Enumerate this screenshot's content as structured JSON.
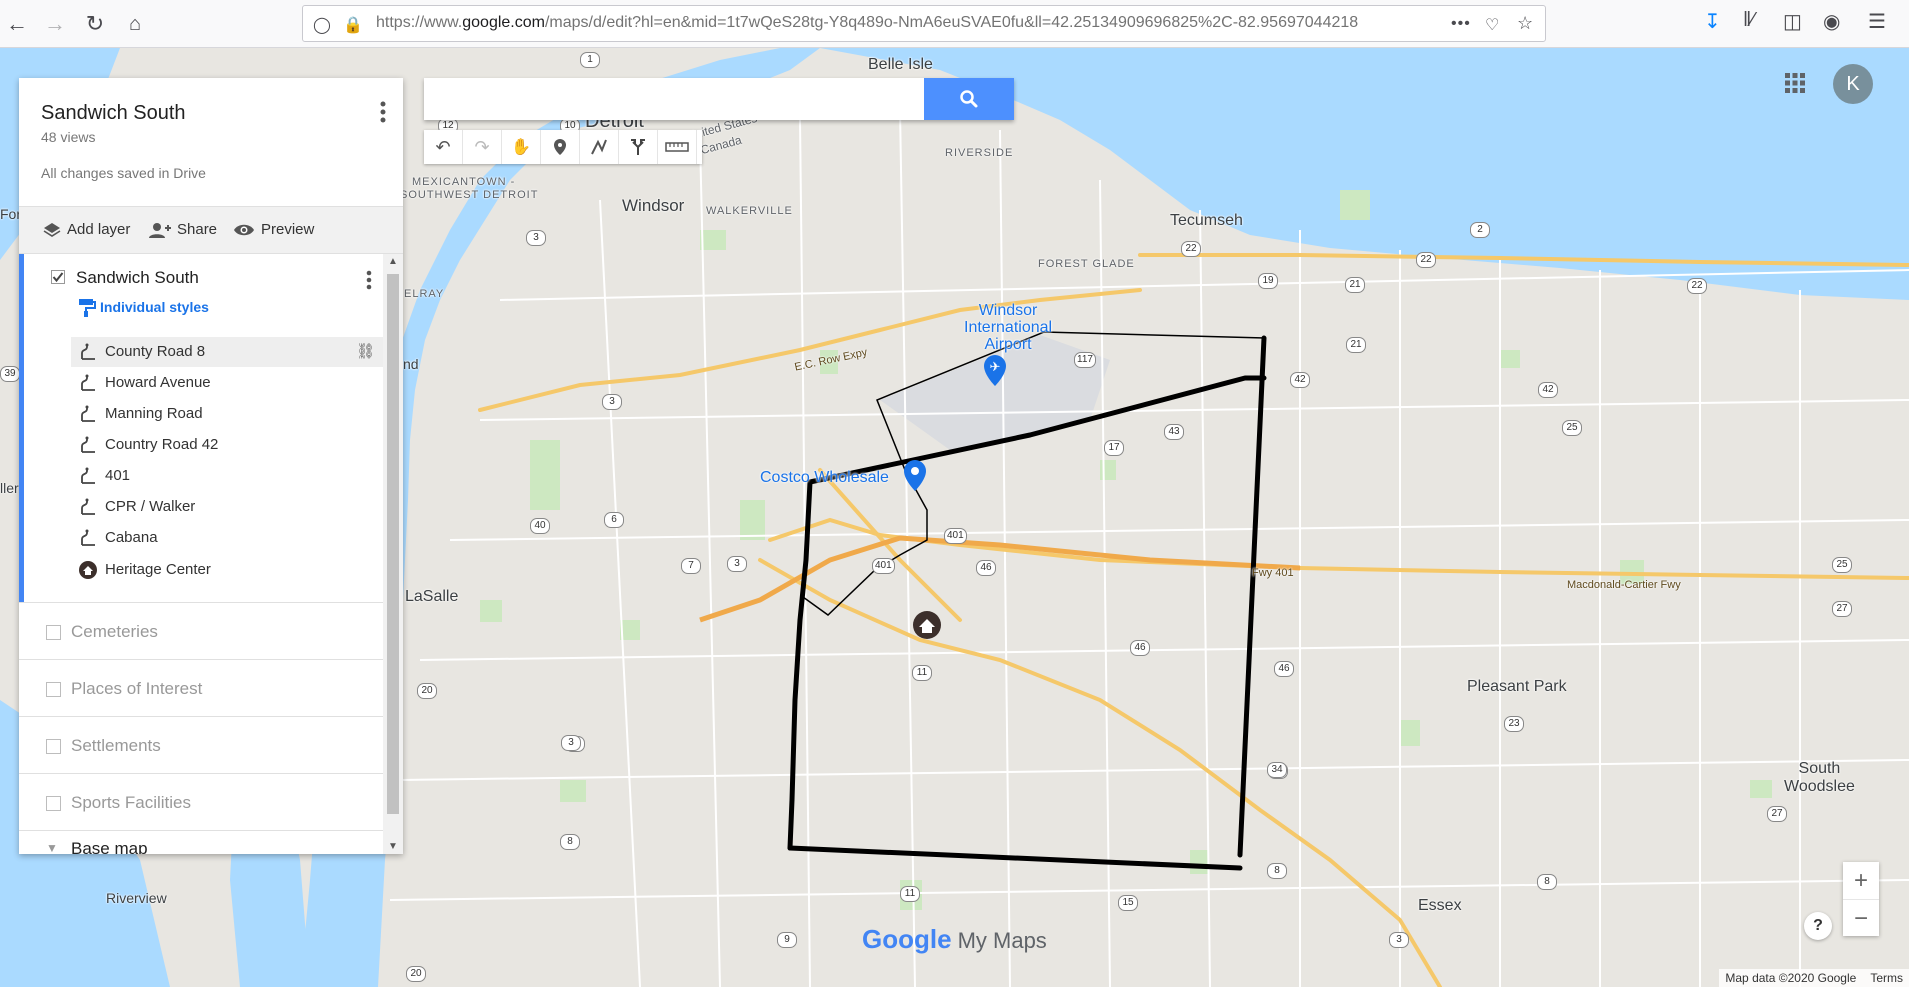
{
  "browser": {
    "url_host_prefix": "https://www.",
    "url_host": "google.com",
    "url_path": "/maps/d/edit?hl=en&mid=1t7wQeS28tg-Y8q489o-NmA6euSVAE0fu&ll=42.25134909696825%2C-82.95697044218",
    "overflow_menu": "•••"
  },
  "search": {
    "value": "",
    "placeholder": ""
  },
  "panel": {
    "map_title": "Sandwich South",
    "views": "48 views",
    "saved_status": "All changes saved in Drive",
    "actions": {
      "add_layer": "Add layer",
      "share": "Share",
      "preview": "Preview"
    },
    "layer": {
      "title": "Sandwich South",
      "styles_link": "Individual styles",
      "features": [
        {
          "label": "County Road 8",
          "kind": "line"
        },
        {
          "label": "Howard Avenue",
          "kind": "line"
        },
        {
          "label": "Manning Road",
          "kind": "line"
        },
        {
          "label": "Country Road 42",
          "kind": "line"
        },
        {
          "label": "401",
          "kind": "line"
        },
        {
          "label": "CPR / Walker",
          "kind": "line"
        },
        {
          "label": "Cabana",
          "kind": "line"
        },
        {
          "label": "Heritage Center",
          "kind": "home-marker"
        }
      ]
    },
    "other_layers": [
      "Cemeteries",
      "Places of Interest",
      "Settlements",
      "Sports Facilities",
      "Base map"
    ]
  },
  "account": {
    "initial": "K"
  },
  "map": {
    "places": {
      "belle_isle": "Belle Isle",
      "detroit": "Detroit",
      "windsor": "Windsor",
      "walkerville": "WALKERVILLE",
      "riverside": "RIVERSIDE",
      "forest_glade": "FOREST GLADE",
      "tecumseh": "Tecumseh",
      "mexicantown": "MEXICANTOWN -",
      "sw_detroit": "SOUTHWEST DETROIT",
      "airport": "Windsor International Airport",
      "airport_l1": "Windsor",
      "airport_l2": "International",
      "airport_l3": "Airport",
      "costco": "Costco Wholesale",
      "lasalle": "LaSalle",
      "pleasant_park": "Pleasant Park",
      "south_woodslee_1": "South",
      "south_woodslee_2": "Woodslee",
      "essex": "Essex",
      "riverview": "Riverview",
      "united_states": "United States",
      "canada": "Canada",
      "ec_row": "E.C. Row Expy",
      "fwy_401": "Fwy 401",
      "macdonald": "Macdonald-Cartier Fwy",
      "elray": "ELRAY",
      "for": "For",
      "nd": "nd",
      "ller": "ller"
    },
    "shields": [
      "1",
      "12",
      "10",
      "3",
      "2",
      "22",
      "22",
      "22",
      "19",
      "21",
      "21",
      "117",
      "42",
      "42",
      "25",
      "43",
      "17",
      "40",
      "3",
      "6",
      "7",
      "3",
      "401",
      "46",
      "401",
      "46",
      "25",
      "27",
      "46",
      "20",
      "3",
      "3",
      "8",
      "11",
      "34",
      "8",
      "9",
      "11",
      "15",
      "20",
      "27",
      "23",
      "34",
      "8",
      "3",
      "39"
    ]
  },
  "logo": {
    "google": "Google",
    "my_maps": "My Maps"
  },
  "attribution": {
    "data": "Map data ©2020 Google",
    "terms": "Terms"
  },
  "zoom": {
    "in": "+",
    "out": "−"
  },
  "help": "?"
}
